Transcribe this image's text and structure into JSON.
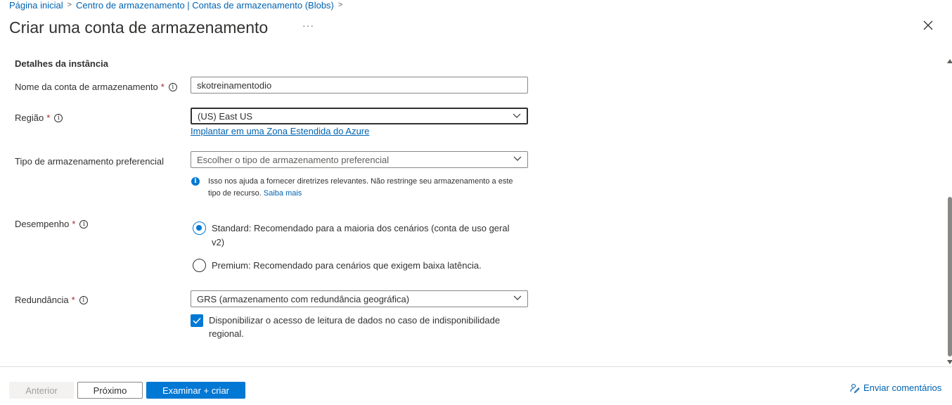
{
  "breadcrumb": {
    "items": [
      "Página inicial",
      "Centro de armazenamento | Contas de armazenamento (Blobs)"
    ],
    "separator": ">"
  },
  "header": {
    "title": "Criar uma conta de armazenamento",
    "more": "···"
  },
  "section": {
    "title": "Detalhes da instância"
  },
  "fields": {
    "account_name": {
      "label": "Nome da conta de armazenamento",
      "required": "*",
      "value": "skotreinamentodio"
    },
    "region": {
      "label": "Região",
      "required": "*",
      "value": "(US) East US",
      "link": "Implantar em uma Zona Estendida do Azure"
    },
    "storage_type": {
      "label": "Tipo de armazenamento preferencial",
      "placeholder": "Escolher o tipo de armazenamento preferencial",
      "note": "Isso nos ajuda a fornecer diretrizes relevantes. Não restringe seu armazenamento a este tipo de recurso.",
      "note_link": "Saiba mais"
    },
    "performance": {
      "label": "Desempenho",
      "required": "*",
      "options": [
        {
          "label": "Standard: Recomendado para a maioria dos cenários (conta de uso geral v2)",
          "selected": true
        },
        {
          "label": "Premium: Recomendado para cenários que exigem baixa latência.",
          "selected": false
        }
      ]
    },
    "redundancy": {
      "label": "Redundância",
      "required": "*",
      "value": "GRS (armazenamento com redundância geográfica)",
      "checkbox_label": "Disponibilizar o acesso de leitura de dados no caso de indisponibilidade regional.",
      "checkbox_checked": true
    }
  },
  "footer": {
    "prev_label": "Anterior",
    "next_label": "Próximo",
    "review_label": "Examinar + criar",
    "feedback_label": "Enviar comentários"
  },
  "colors": {
    "accent": "#0078d4",
    "link": "#0063b1",
    "text": "#323130",
    "required": "#a4262c"
  }
}
